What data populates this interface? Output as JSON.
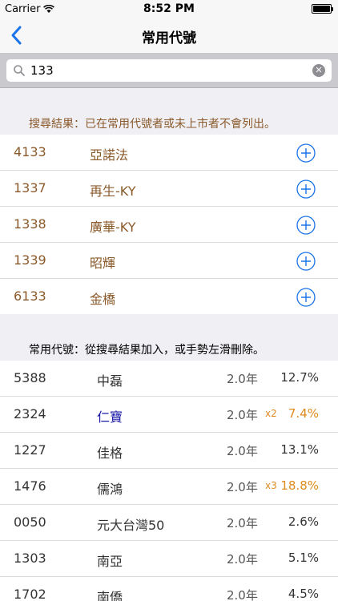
{
  "status_bar": {
    "carrier": "Carrier",
    "time": "8:52 PM"
  },
  "nav": {
    "title": "常用代號"
  },
  "search": {
    "value": "133",
    "placeholder": ""
  },
  "results_header": "搜尋結果：已在常用代號者或未上市者不會列出。",
  "results": [
    {
      "code": "4133",
      "name": "亞諾法"
    },
    {
      "code": "1337",
      "name": "再生-KY"
    },
    {
      "code": "1338",
      "name": "廣華-KY"
    },
    {
      "code": "1339",
      "name": "昭輝"
    },
    {
      "code": "6133",
      "name": "金橋"
    }
  ],
  "favorites_header": "常用代號：從搜尋結果加入，或手勢左滑刪除。",
  "favorites": [
    {
      "code": "5388",
      "name": "中磊",
      "years": "2.0年",
      "mult": "",
      "pct": "12.7%",
      "highlight": false,
      "name_blue": false
    },
    {
      "code": "2324",
      "name": "仁寶",
      "years": "2.0年",
      "mult": "x2",
      "pct": "7.4%",
      "highlight": true,
      "name_blue": true
    },
    {
      "code": "1227",
      "name": "佳格",
      "years": "2.0年",
      "mult": "",
      "pct": "13.1%",
      "highlight": false,
      "name_blue": false
    },
    {
      "code": "1476",
      "name": "儒鴻",
      "years": "2.0年",
      "mult": "x3",
      "pct": "18.8%",
      "highlight": true,
      "name_blue": false
    },
    {
      "code": "0050",
      "name": "元大台灣50",
      "years": "2.0年",
      "mult": "",
      "pct": "2.6%",
      "highlight": false,
      "name_blue": false
    },
    {
      "code": "1303",
      "name": "南亞",
      "years": "2.0年",
      "mult": "",
      "pct": "5.1%",
      "highlight": false,
      "name_blue": false
    },
    {
      "code": "1702",
      "name": "南僑",
      "years": "2.0年",
      "mult": "",
      "pct": "4.5%",
      "highlight": false,
      "name_blue": false
    }
  ],
  "colors": {
    "accent": "#1a73e8",
    "brown": "#8b5a2b",
    "orange": "#e08a1e",
    "blue_name": "#1a1aa6"
  },
  "icons": {
    "back": "chevron-left-icon",
    "wifi": "wifi-icon",
    "battery": "battery-icon",
    "search": "search-icon",
    "clear": "clear-icon",
    "add": "plus-circle-icon"
  }
}
